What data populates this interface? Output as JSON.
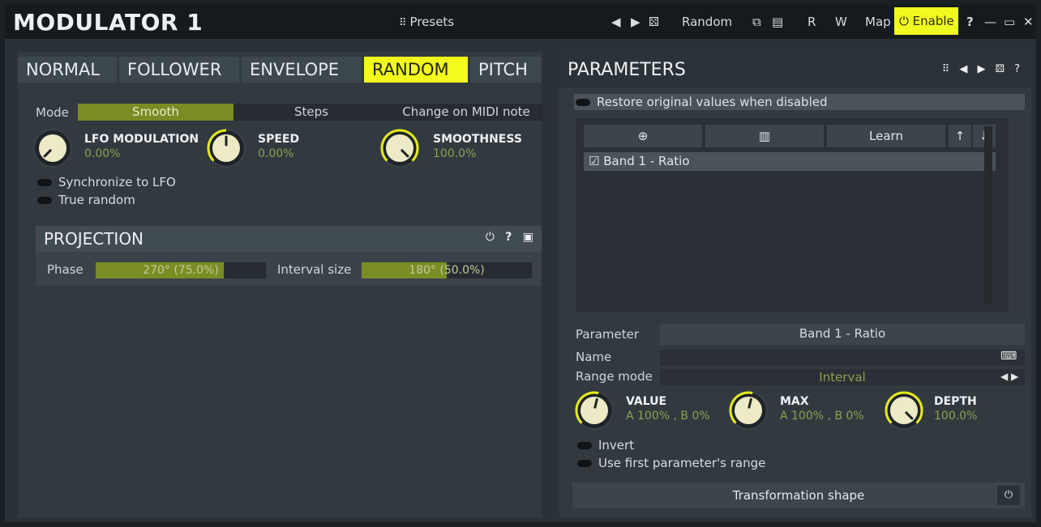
{
  "app": {
    "title": "MODULATOR 1",
    "presets_label": "Presets",
    "nav_prev": "◀",
    "nav_next": "▶",
    "nav_random_icon": "dice-icon",
    "random_label": "Random",
    "copy_icon": "copy-icon",
    "paste_icon": "paste-icon",
    "r_label": "R",
    "w_label": "W",
    "map_label": "Map",
    "enable_label": "Enable",
    "help_label": "?",
    "minimize_label": "—",
    "maximize_label": "▭",
    "close_label": "✕",
    "accent_color": "#f2fb1c"
  },
  "left": {
    "tabs": [
      {
        "label": "NORMAL",
        "active": false
      },
      {
        "label": "FOLLOWER",
        "active": false
      },
      {
        "label": "ENVELOPE",
        "active": false
      },
      {
        "label": "RANDOM",
        "active": true
      },
      {
        "label": "PITCH",
        "active": false
      }
    ],
    "mode_label": "Mode",
    "mode_options": [
      "Smooth",
      "Steps",
      "Change on MIDI note"
    ],
    "mode_selected": "Smooth",
    "knobs": [
      {
        "label": "LFO MODULATION",
        "value": "0.00%",
        "level": 0.0
      },
      {
        "label": "SPEED",
        "value": "0.00%",
        "level": 0.5
      },
      {
        "label": "SMOOTHNESS",
        "value": "100.0%",
        "level": 1.0
      }
    ],
    "sync_label": "Synchronize to LFO",
    "true_random_label": "True random",
    "projection": {
      "title": "PROJECTION",
      "power_icon": "⏻",
      "help_icon": "?",
      "menu_icon": "▣",
      "phase_label": "Phase",
      "phase_value": "270° (75.0%)",
      "phase_fraction": 0.75,
      "interval_label": "Interval size",
      "interval_value": "180° (50.0%)",
      "interval_fraction": 0.5
    }
  },
  "right": {
    "title": "PARAMETERS",
    "head_icons": "⠿ ◀ ▶ ⚄ ?",
    "restore_label": "Restore original values when disabled",
    "list_add": "⊕",
    "list_delete": "🗑",
    "list_learn": "Learn",
    "list_up": "↑",
    "list_down": "↓",
    "items": [
      {
        "label": "Band 1 - Ratio",
        "checked": true
      }
    ],
    "parameter_label": "Parameter",
    "parameter_value": "Band 1 - Ratio",
    "name_label": "Name",
    "name_value": "",
    "range_mode_label": "Range mode",
    "range_mode_value": "Interval",
    "range_arrows": "◀ ▶",
    "knobs": [
      {
        "label": "VALUE",
        "value": "A 100% , B 0%",
        "level": 0.55
      },
      {
        "label": "MAX",
        "value": "A 100% , B 0%",
        "level": 0.55
      },
      {
        "label": "DEPTH",
        "value": "100.0%",
        "level": 1.0
      }
    ],
    "invert_label": "Invert",
    "use_first_label": "Use first parameter's range",
    "transform_label": "Transformation shape",
    "transform_power": "⏻"
  }
}
